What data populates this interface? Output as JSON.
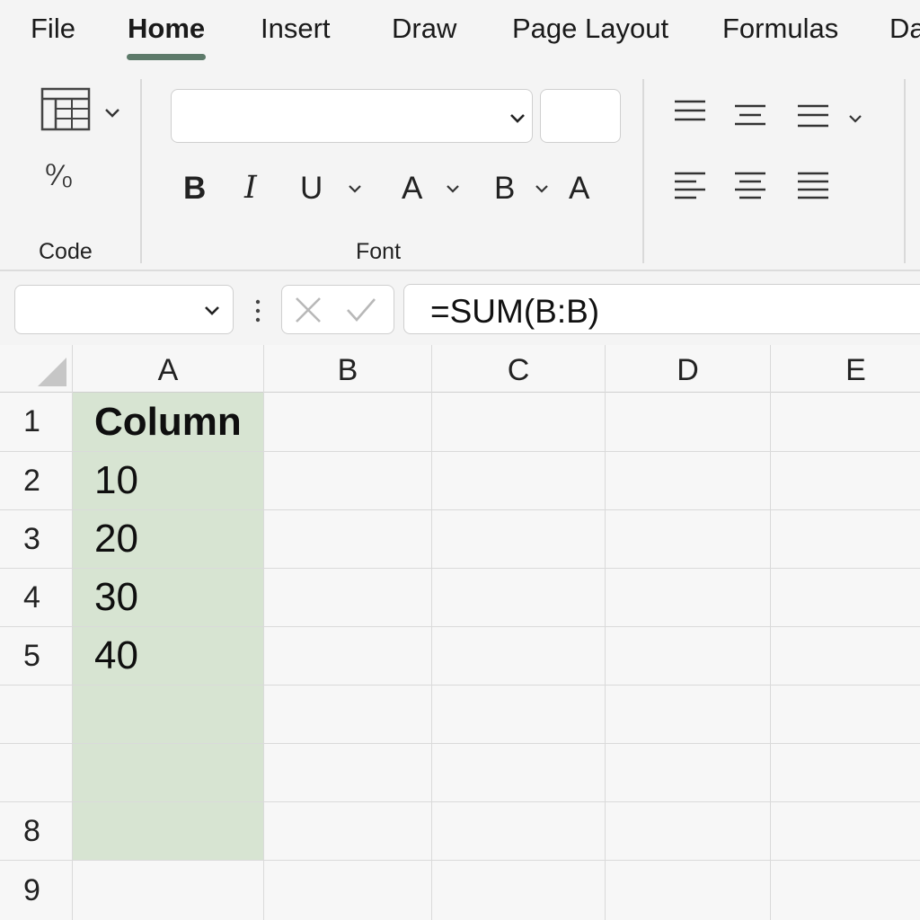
{
  "tabs": [
    {
      "label": "File"
    },
    {
      "label": "Home"
    },
    {
      "label": "Insert"
    },
    {
      "label": "Draw"
    },
    {
      "label": "Page Layout"
    },
    {
      "label": "Formulas"
    },
    {
      "label": "Da"
    }
  ],
  "active_tab": "Home",
  "ribbon": {
    "groups": {
      "code": {
        "label": "Code",
        "percent_symbol": "⁰⁄₀"
      },
      "font": {
        "label": "Font",
        "font_name": "",
        "font_size": "",
        "bold": "B",
        "italic": "I",
        "underline": "U",
        "font_color": "A",
        "fill_color": "B",
        "grow_font": "A"
      }
    }
  },
  "formula_bar": {
    "name_box": "",
    "formula": "=SUM(B:B)"
  },
  "sheet": {
    "columns": [
      "A",
      "B",
      "C",
      "D",
      "E"
    ],
    "rows": [
      "1",
      "2",
      "3",
      "4",
      "5",
      "",
      "",
      "8",
      "9"
    ],
    "column_a_values": [
      "Column",
      "10",
      "20",
      "30",
      "40",
      "",
      "",
      ""
    ],
    "selection_fill": "#d7e4d2"
  },
  "colors": {
    "accent": "#5d7a6a",
    "background": "#f4f4f4"
  }
}
